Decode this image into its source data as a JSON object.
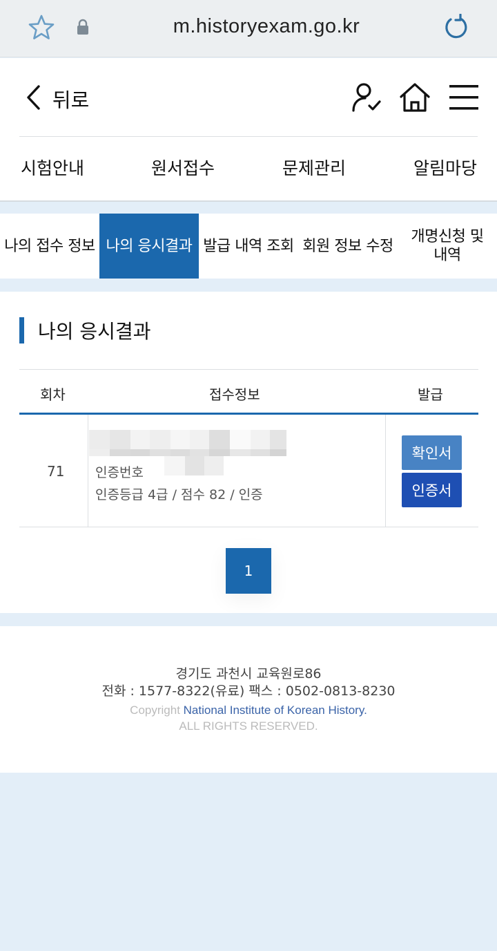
{
  "browser": {
    "url": "m.historyexam.go.kr"
  },
  "header": {
    "back_label": "뒤로",
    "nav": [
      "시험안내",
      "원서접수",
      "문제관리",
      "알림마당"
    ]
  },
  "subtabs": [
    {
      "label": "나의 접수 정보",
      "active": false
    },
    {
      "label": "나의 응시결과",
      "active": true
    },
    {
      "label": "발급 내역 조회",
      "active": false
    },
    {
      "label": "회원 정보 수정",
      "active": false
    },
    {
      "label": "개명신청 및\n내역",
      "active": false
    }
  ],
  "section": {
    "title": "나의 응시결과"
  },
  "table": {
    "headers": [
      "회차",
      "접수정보",
      "발급"
    ],
    "rows": [
      {
        "round": "71",
        "cert_no_label": "인증번호",
        "result": "인증등급 4급 / 점수 82 / 인증",
        "buttons": [
          "확인서",
          "인증서"
        ]
      }
    ]
  },
  "pagination": {
    "current": "1"
  },
  "footer": {
    "address": "경기도 과천시 교육원로86",
    "tel": "전화 : 1577-8322(유료) 팩스 : 0502-0813-8230",
    "copyright_prefix": "Copyright ",
    "institute": "National Institute of Korean History.",
    "rights": "ALL RIGHTS RESERVED."
  },
  "colors": {
    "primary": "#1b68ad",
    "confirm_button": "#4883c4",
    "cert_button": "#1e4fb3",
    "page_bg": "#e3eef8"
  }
}
